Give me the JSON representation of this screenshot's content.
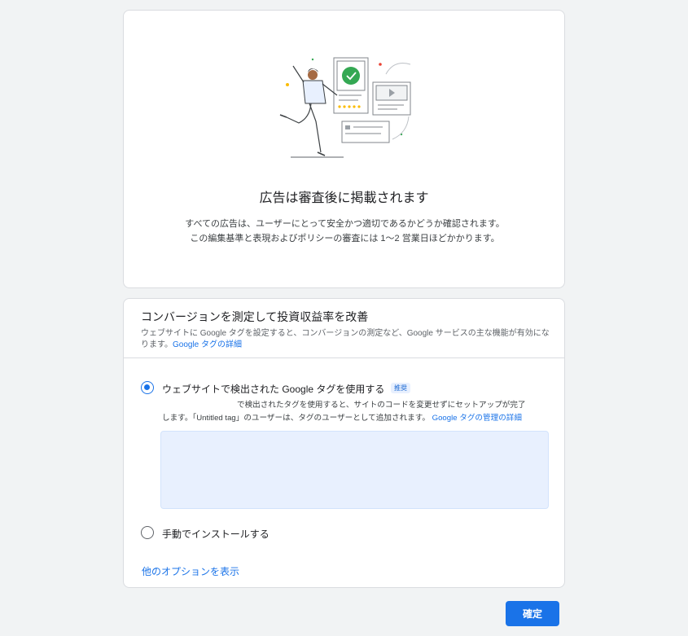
{
  "review": {
    "title": "広告は審査後に掲載されます",
    "description": "すべての広告は、ユーザーにとって安全かつ適切であるかどうか確認されます。この編集基準と表現およびポリシーの審査には 1〜2 営業日ほどかかります。"
  },
  "conversion": {
    "title": "コンバージョンを測定して投資収益率を改善",
    "description": "ウェブサイトに Google タグを設定すると、コンバージョンの測定など、Google サービスの主な機能が有効になります。",
    "learn_more_link": "Google タグの詳細",
    "options": [
      {
        "label": "ウェブサイトで検出された Google タグを使用する",
        "badge": "推奨",
        "selected": true,
        "description_line1": "で検出されたタグを使用すると、サイトのコードを変更せずにセットアップが完了",
        "description_line2": "します。「Untitled tag」のユーザーは、タグのユーザーとして追加されます。",
        "link": "Google タグの管理の詳細"
      },
      {
        "label": "手動でインストールする",
        "selected": false
      }
    ],
    "more_options": "他のオプションを表示"
  },
  "footer": {
    "confirm_label": "確定"
  },
  "colors": {
    "accent": "#1a73e8",
    "background": "#f1f3f4",
    "check_green": "#34a853"
  }
}
